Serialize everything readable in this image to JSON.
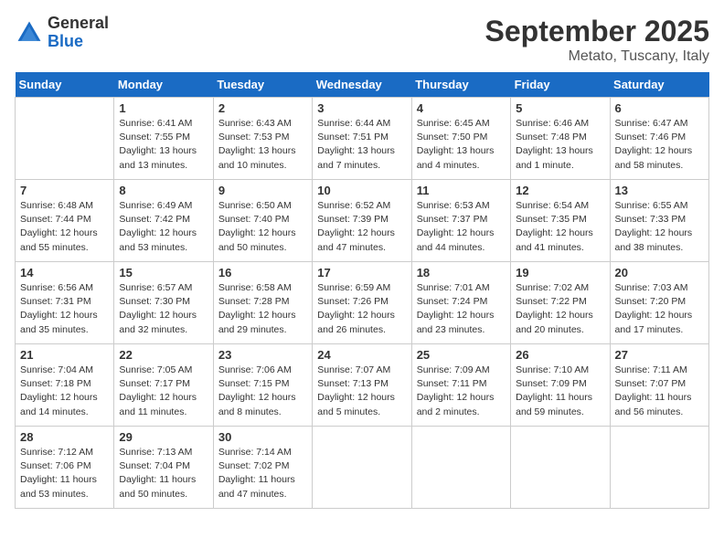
{
  "header": {
    "logo_general": "General",
    "logo_blue": "Blue",
    "month_title": "September 2025",
    "location": "Metato, Tuscany, Italy"
  },
  "days_of_week": [
    "Sunday",
    "Monday",
    "Tuesday",
    "Wednesday",
    "Thursday",
    "Friday",
    "Saturday"
  ],
  "weeks": [
    [
      {
        "day": "",
        "info": ""
      },
      {
        "day": "1",
        "info": "Sunrise: 6:41 AM\nSunset: 7:55 PM\nDaylight: 13 hours\nand 13 minutes."
      },
      {
        "day": "2",
        "info": "Sunrise: 6:43 AM\nSunset: 7:53 PM\nDaylight: 13 hours\nand 10 minutes."
      },
      {
        "day": "3",
        "info": "Sunrise: 6:44 AM\nSunset: 7:51 PM\nDaylight: 13 hours\nand 7 minutes."
      },
      {
        "day": "4",
        "info": "Sunrise: 6:45 AM\nSunset: 7:50 PM\nDaylight: 13 hours\nand 4 minutes."
      },
      {
        "day": "5",
        "info": "Sunrise: 6:46 AM\nSunset: 7:48 PM\nDaylight: 13 hours\nand 1 minute."
      },
      {
        "day": "6",
        "info": "Sunrise: 6:47 AM\nSunset: 7:46 PM\nDaylight: 12 hours\nand 58 minutes."
      }
    ],
    [
      {
        "day": "7",
        "info": "Sunrise: 6:48 AM\nSunset: 7:44 PM\nDaylight: 12 hours\nand 55 minutes."
      },
      {
        "day": "8",
        "info": "Sunrise: 6:49 AM\nSunset: 7:42 PM\nDaylight: 12 hours\nand 53 minutes."
      },
      {
        "day": "9",
        "info": "Sunrise: 6:50 AM\nSunset: 7:40 PM\nDaylight: 12 hours\nand 50 minutes."
      },
      {
        "day": "10",
        "info": "Sunrise: 6:52 AM\nSunset: 7:39 PM\nDaylight: 12 hours\nand 47 minutes."
      },
      {
        "day": "11",
        "info": "Sunrise: 6:53 AM\nSunset: 7:37 PM\nDaylight: 12 hours\nand 44 minutes."
      },
      {
        "day": "12",
        "info": "Sunrise: 6:54 AM\nSunset: 7:35 PM\nDaylight: 12 hours\nand 41 minutes."
      },
      {
        "day": "13",
        "info": "Sunrise: 6:55 AM\nSunset: 7:33 PM\nDaylight: 12 hours\nand 38 minutes."
      }
    ],
    [
      {
        "day": "14",
        "info": "Sunrise: 6:56 AM\nSunset: 7:31 PM\nDaylight: 12 hours\nand 35 minutes."
      },
      {
        "day": "15",
        "info": "Sunrise: 6:57 AM\nSunset: 7:30 PM\nDaylight: 12 hours\nand 32 minutes."
      },
      {
        "day": "16",
        "info": "Sunrise: 6:58 AM\nSunset: 7:28 PM\nDaylight: 12 hours\nand 29 minutes."
      },
      {
        "day": "17",
        "info": "Sunrise: 6:59 AM\nSunset: 7:26 PM\nDaylight: 12 hours\nand 26 minutes."
      },
      {
        "day": "18",
        "info": "Sunrise: 7:01 AM\nSunset: 7:24 PM\nDaylight: 12 hours\nand 23 minutes."
      },
      {
        "day": "19",
        "info": "Sunrise: 7:02 AM\nSunset: 7:22 PM\nDaylight: 12 hours\nand 20 minutes."
      },
      {
        "day": "20",
        "info": "Sunrise: 7:03 AM\nSunset: 7:20 PM\nDaylight: 12 hours\nand 17 minutes."
      }
    ],
    [
      {
        "day": "21",
        "info": "Sunrise: 7:04 AM\nSunset: 7:18 PM\nDaylight: 12 hours\nand 14 minutes."
      },
      {
        "day": "22",
        "info": "Sunrise: 7:05 AM\nSunset: 7:17 PM\nDaylight: 12 hours\nand 11 minutes."
      },
      {
        "day": "23",
        "info": "Sunrise: 7:06 AM\nSunset: 7:15 PM\nDaylight: 12 hours\nand 8 minutes."
      },
      {
        "day": "24",
        "info": "Sunrise: 7:07 AM\nSunset: 7:13 PM\nDaylight: 12 hours\nand 5 minutes."
      },
      {
        "day": "25",
        "info": "Sunrise: 7:09 AM\nSunset: 7:11 PM\nDaylight: 12 hours\nand 2 minutes."
      },
      {
        "day": "26",
        "info": "Sunrise: 7:10 AM\nSunset: 7:09 PM\nDaylight: 11 hours\nand 59 minutes."
      },
      {
        "day": "27",
        "info": "Sunrise: 7:11 AM\nSunset: 7:07 PM\nDaylight: 11 hours\nand 56 minutes."
      }
    ],
    [
      {
        "day": "28",
        "info": "Sunrise: 7:12 AM\nSunset: 7:06 PM\nDaylight: 11 hours\nand 53 minutes."
      },
      {
        "day": "29",
        "info": "Sunrise: 7:13 AM\nSunset: 7:04 PM\nDaylight: 11 hours\nand 50 minutes."
      },
      {
        "day": "30",
        "info": "Sunrise: 7:14 AM\nSunset: 7:02 PM\nDaylight: 11 hours\nand 47 minutes."
      },
      {
        "day": "",
        "info": ""
      },
      {
        "day": "",
        "info": ""
      },
      {
        "day": "",
        "info": ""
      },
      {
        "day": "",
        "info": ""
      }
    ]
  ]
}
